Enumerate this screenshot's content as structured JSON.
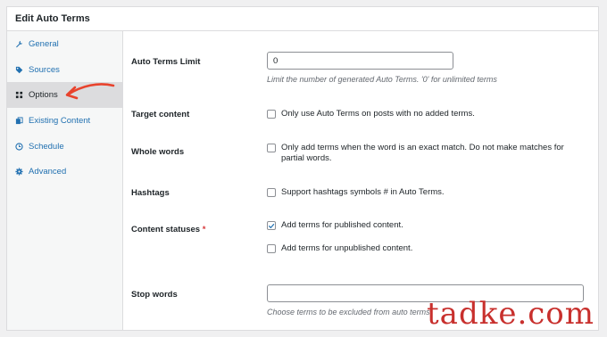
{
  "panel": {
    "title": "Edit Auto Terms"
  },
  "sidebar": {
    "items": [
      {
        "label": "General",
        "icon": "wrench-icon"
      },
      {
        "label": "Sources",
        "icon": "tag-icon"
      },
      {
        "label": "Options",
        "icon": "grid-icon",
        "active": true
      },
      {
        "label": "Existing Content",
        "icon": "copy-icon"
      },
      {
        "label": "Schedule",
        "icon": "clock-icon"
      },
      {
        "label": "Advanced",
        "icon": "gear-icon"
      }
    ]
  },
  "form": {
    "auto_terms_limit": {
      "label": "Auto Terms Limit",
      "value": "0",
      "description": "Limit the number of generated Auto Terms. '0' for unlimited terms"
    },
    "target_content": {
      "label": "Target content",
      "checkbox_label": "Only use Auto Terms on posts with no added terms.",
      "checked": false
    },
    "whole_words": {
      "label": "Whole words",
      "checkbox_label_line1": "Only add terms when the word is an exact match. Do not make matches for",
      "checkbox_label_line2": "partial words.",
      "checked": false
    },
    "hashtags": {
      "label": "Hashtags",
      "checkbox_label": "Support hashtags symbols # in Auto Terms.",
      "checked": false
    },
    "content_statuses": {
      "label": "Content statuses",
      "required_mark": "*",
      "options": [
        {
          "label": "Add terms for published content.",
          "checked": true
        },
        {
          "label": "Add terms for unpublished content.",
          "checked": false
        }
      ]
    },
    "stop_words": {
      "label": "Stop words",
      "value": "",
      "description": "Choose terms to be excluded from auto terms."
    }
  },
  "annotation": {
    "arrow_color": "#e8432d"
  },
  "watermark": {
    "text": "tadke.com"
  },
  "colors": {
    "link": "#2271b1",
    "required": "#d63638",
    "active_bg": "#dcdcde"
  }
}
